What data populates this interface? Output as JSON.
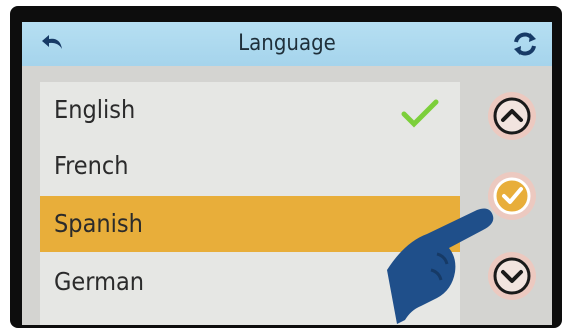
{
  "header": {
    "title": "Language",
    "back_icon": "back-arrow-icon",
    "refresh_icon": "refresh-icon"
  },
  "languages": [
    {
      "label": "English",
      "checked": true
    },
    {
      "label": "French"
    },
    {
      "label": "Spanish",
      "highlighted": true
    },
    {
      "label": "German"
    }
  ],
  "side_buttons": {
    "up_icon": "chevron-up-icon",
    "confirm_icon": "check-icon",
    "down_icon": "chevron-down-icon"
  },
  "colors": {
    "header": "#a9d6ee",
    "highlight": "#e8ae3a",
    "check": "#7ccf3a",
    "hand": "#1f4f8a"
  }
}
